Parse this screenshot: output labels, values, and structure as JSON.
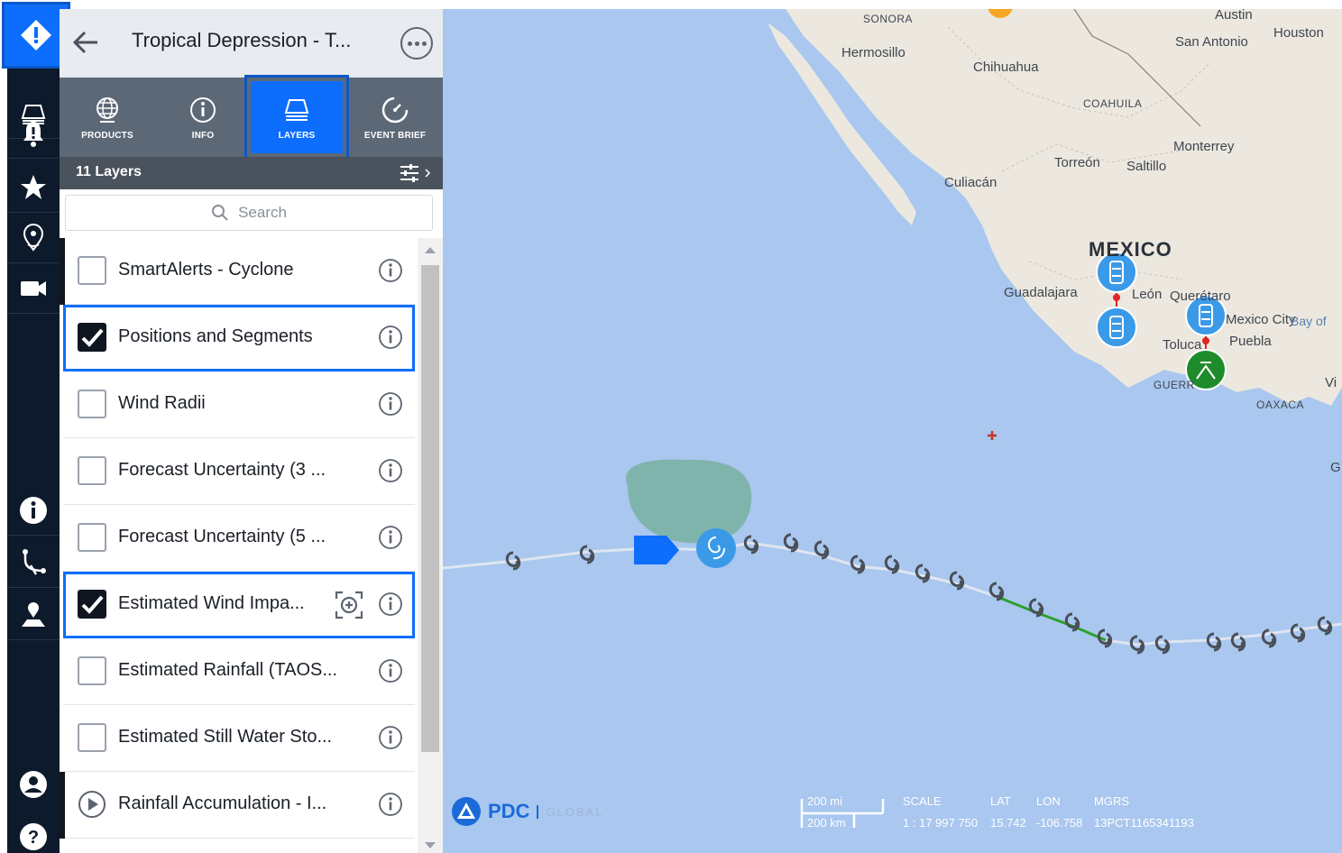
{
  "panel": {
    "title": "Tropical Depression - T...",
    "tabs": [
      {
        "label": "PRODUCTS",
        "icon": "globe-icon"
      },
      {
        "label": "INFO",
        "icon": "info-icon"
      },
      {
        "label": "LAYERS",
        "icon": "layers-icon",
        "active": true
      },
      {
        "label": "EVENT BRIEF",
        "icon": "gauge-icon"
      }
    ],
    "layers_count": "11 Layers",
    "search_placeholder": "Search",
    "layers": [
      {
        "label": "SmartAlerts - Cyclone",
        "checked": false
      },
      {
        "label": "Positions and Segments",
        "checked": true,
        "highlighted": true
      },
      {
        "label": "Wind Radii",
        "checked": false
      },
      {
        "label": "Forecast Uncertainty (3 ...",
        "checked": false
      },
      {
        "label": "Forecast Uncertainty (5 ...",
        "checked": false
      },
      {
        "label": "Estimated Wind Impa...",
        "checked": true,
        "highlighted": true,
        "zoom": true
      },
      {
        "label": "Estimated Rainfall (TAOS...",
        "checked": false
      },
      {
        "label": "Estimated Still Water Sto...",
        "checked": false
      },
      {
        "label": "Rainfall Accumulation - I...",
        "play": true
      }
    ]
  },
  "rail": {
    "items": [
      "alert-diamond-icon",
      "layers-icon",
      "bell-alert-icon",
      "star-icon",
      "location-pin-icon",
      "video-camera-icon",
      "info-icon",
      "route-icon",
      "map-marker-icon",
      "user-icon",
      "help-icon"
    ]
  },
  "map": {
    "places": {
      "sonora": "SONORA",
      "austin": "Austin",
      "houston": "Houston",
      "san_antonio": "San Antonio",
      "hermosillo": "Hermosillo",
      "chihuahua": "Chihuahua",
      "coahuila": "COAHUILA",
      "monterrey": "Monterrey",
      "torreon": "Torreón",
      "saltillo": "Saltillo",
      "culiacan": "Culiacán",
      "mexico": "MEXICO",
      "guadalajara": "Guadalajara",
      "leon": "León",
      "queretaro": "Querétaro",
      "mexico_city": "Mexico City",
      "bay_of": "Bay of",
      "toluca": "Toluca",
      "puebla": "Puebla",
      "guerrero": "GUERR",
      "oaxaca": "OAXACA",
      "vi": "Vi",
      "g": "G"
    },
    "track_color": "#2ca02c",
    "footer": {
      "brand": "PDC",
      "brand_sub": "GLOBAL",
      "scale_mi": "200 mi",
      "scale_km": "200 km",
      "scale_label": "SCALE",
      "scale_value": "1 : 17 997 750",
      "lat_label": "LAT",
      "lat_value": "15.742",
      "lon_label": "LON",
      "lon_value": "-106.758",
      "mgrs_label": "MGRS",
      "mgrs_value": "13PCT1165341193"
    }
  }
}
